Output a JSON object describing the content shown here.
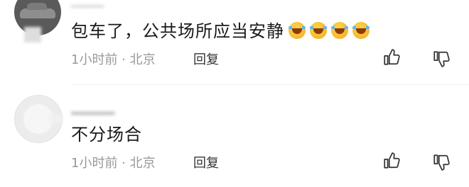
{
  "comments": [
    {
      "text": "包车了，公共场所应当安静",
      "emoji_count": 4,
      "emoji_icon": "laughing-tears-emoji",
      "meta": "1小时前 · 北京",
      "reply_label": "回复"
    },
    {
      "text": "不分场合",
      "meta": "1小时前 · 北京",
      "reply_label": "回复"
    }
  ],
  "colors": {
    "text": "#1a1a1a",
    "meta": "#999999",
    "reply": "#333333",
    "icon": "#333333"
  }
}
